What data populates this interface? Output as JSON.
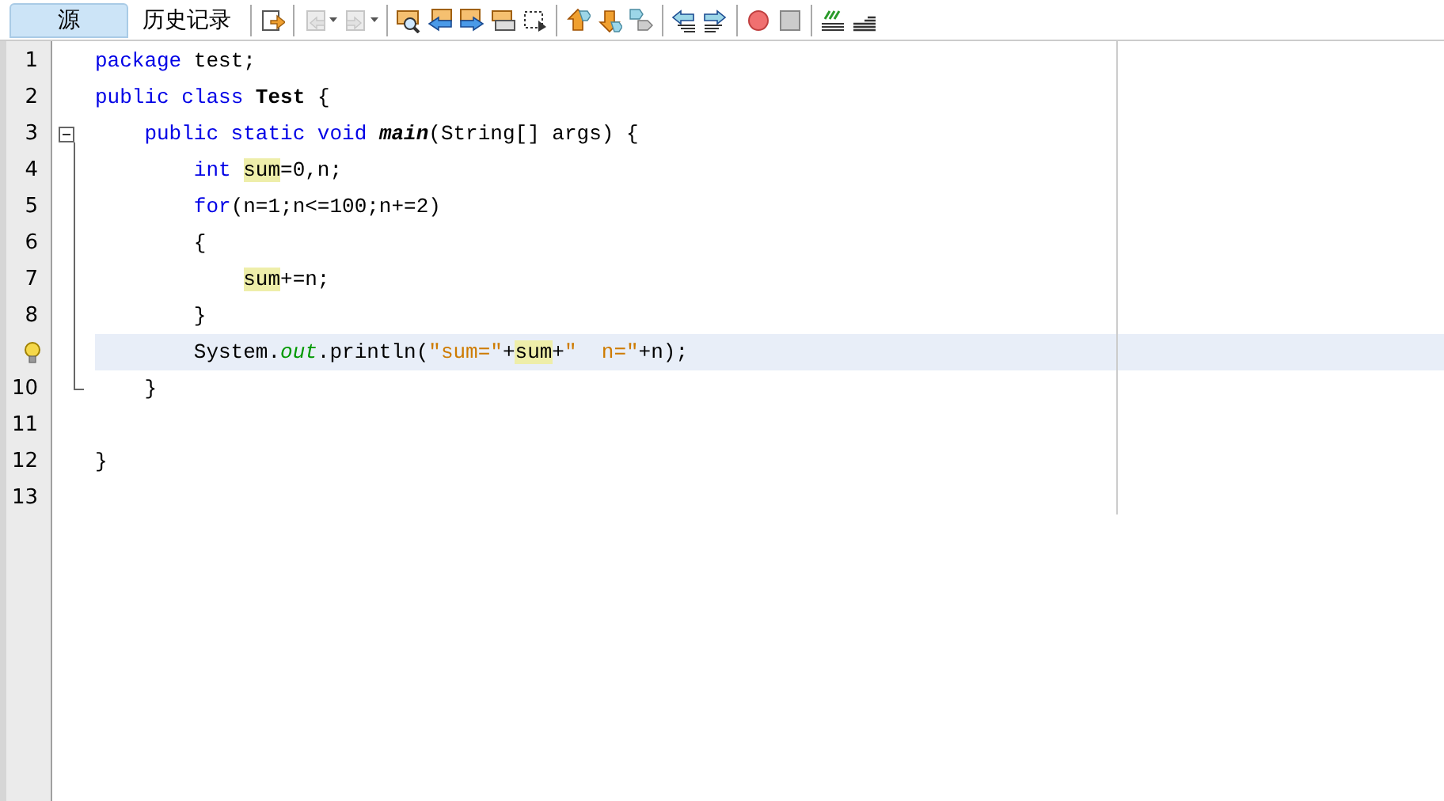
{
  "tabs": [
    {
      "label": "源",
      "selected": true
    },
    {
      "label": "历史记录",
      "selected": false
    }
  ],
  "toolbar": [
    [
      {
        "kind": "jump",
        "disabled": false,
        "dropdown": false
      }
    ],
    [
      {
        "kind": "back",
        "disabled": true,
        "dropdown": true
      },
      {
        "kind": "forward",
        "disabled": true,
        "dropdown": true
      }
    ],
    [
      {
        "kind": "find",
        "disabled": false,
        "dropdown": false
      },
      {
        "kind": "findprev",
        "disabled": false,
        "dropdown": false
      },
      {
        "kind": "findnext",
        "disabled": false,
        "dropdown": false
      },
      {
        "kind": "highlight",
        "disabled": false,
        "dropdown": false
      },
      {
        "kind": "rectselect",
        "disabled": false,
        "dropdown": false
      }
    ],
    [
      {
        "kind": "bookprev",
        "disabled": false,
        "dropdown": false
      },
      {
        "kind": "booknext",
        "disabled": false,
        "dropdown": false
      },
      {
        "kind": "booktoggle",
        "disabled": false,
        "dropdown": false
      }
    ],
    [
      {
        "kind": "shiftleft",
        "disabled": false,
        "dropdown": false
      },
      {
        "kind": "shiftright",
        "disabled": false,
        "dropdown": false
      }
    ],
    [
      {
        "kind": "record",
        "disabled": false,
        "dropdown": false
      },
      {
        "kind": "stop",
        "disabled": false,
        "dropdown": false
      }
    ],
    [
      {
        "kind": "comment",
        "disabled": false,
        "dropdown": false
      },
      {
        "kind": "uncomment",
        "disabled": false,
        "dropdown": false
      }
    ]
  ],
  "editor": {
    "lines": [
      {
        "number": "1",
        "hint": false,
        "current": false,
        "tokens": [
          {
            "kind": "keyword",
            "text": "package"
          },
          {
            "kind": "plain",
            "text": " test;"
          }
        ]
      },
      {
        "number": "2",
        "hint": false,
        "current": false,
        "tokens": [
          {
            "kind": "keyword",
            "text": "public class "
          },
          {
            "kind": "bold",
            "text": "Test"
          },
          {
            "kind": "plain",
            "text": " {"
          }
        ],
        "children": [
          {
            "number": "3",
            "hint": false,
            "expanded": true,
            "current": false,
            "tokens": [
              {
                "kind": "keyword",
                "text": "public static void "
              },
              {
                "kind": "bolditalic",
                "text": "main"
              },
              {
                "kind": "plain",
                "text": "(String[] args) {"
              }
            ],
            "children": [
              {
                "number": "4",
                "hint": false,
                "current": false,
                "tokens": [
                  {
                    "kind": "keyword",
                    "text": "int "
                  },
                  {
                    "kind": "mark",
                    "text": "sum"
                  },
                  {
                    "kind": "plain",
                    "text": "=0,n;"
                  }
                ]
              },
              {
                "number": "5",
                "hint": false,
                "current": false,
                "tokens": [
                  {
                    "kind": "keyword",
                    "text": "for"
                  },
                  {
                    "kind": "plain",
                    "text": "(n=1;n<=100;n+=2)"
                  }
                ]
              },
              {
                "number": "6",
                "hint": false,
                "current": false,
                "tokens": [
                  {
                    "kind": "plain",
                    "text": "{"
                  }
                ],
                "children": [
                  {
                    "number": "7",
                    "hint": false,
                    "current": false,
                    "tokens": [
                      {
                        "kind": "mark",
                        "text": "sum"
                      },
                      {
                        "kind": "plain",
                        "text": "+=n;"
                      }
                    ]
                  }
                ]
              },
              {
                "number": "8",
                "hint": false,
                "current": false,
                "tokens": [
                  {
                    "kind": "plain",
                    "text": "}"
                  }
                ]
              },
              {
                "hint": true,
                "current": true,
                "tokens": [
                  {
                    "kind": "plain",
                    "text": "System."
                  },
                  {
                    "kind": "field",
                    "text": "out"
                  },
                  {
                    "kind": "plain",
                    "text": ".println("
                  },
                  {
                    "kind": "string",
                    "text": "\"sum=\""
                  },
                  {
                    "kind": "plain",
                    "text": "+"
                  },
                  {
                    "kind": "mark",
                    "text": "sum"
                  },
                  {
                    "kind": "plain",
                    "text": "+"
                  },
                  {
                    "kind": "string",
                    "text": "\"  n=\""
                  },
                  {
                    "kind": "plain",
                    "text": "+n);"
                  }
                ]
              }
            ]
          },
          {
            "number": "10",
            "hint": false,
            "current": false,
            "tokens": [
              {
                "kind": "plain",
                "text": "}"
              }
            ]
          }
        ]
      },
      {
        "number": "11",
        "hint": false,
        "current": false
      },
      {
        "number": "12",
        "hint": false,
        "current": false,
        "tokens": [
          {
            "kind": "plain",
            "text": "}"
          }
        ]
      },
      {
        "number": "13",
        "hint": false,
        "current": false
      }
    ]
  }
}
